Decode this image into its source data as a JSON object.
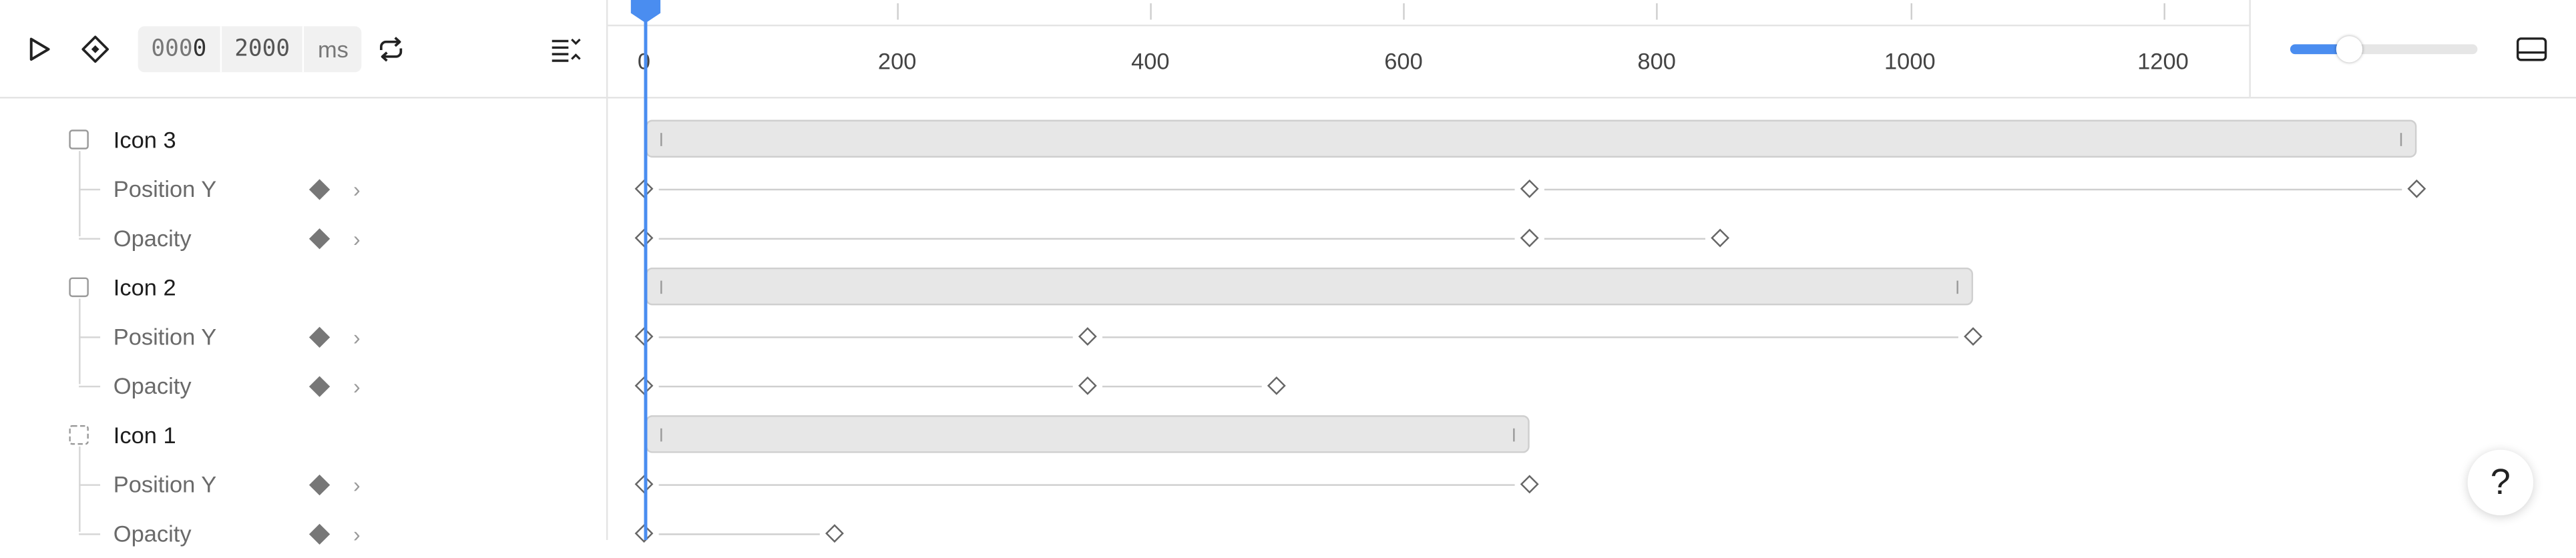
{
  "toolbar": {
    "current_time_prefix": "000",
    "current_time_last": "0",
    "duration": "2000",
    "unit": "ms"
  },
  "ruler": {
    "labels": [
      "0",
      "200",
      "400",
      "600",
      "800",
      "1000",
      "1200"
    ]
  },
  "layers": [
    {
      "name": "Icon 3",
      "props": [
        {
          "name": "Position Y"
        },
        {
          "name": "Opacity"
        }
      ]
    },
    {
      "name": "Icon 2",
      "props": [
        {
          "name": "Position Y"
        },
        {
          "name": "Opacity"
        }
      ]
    },
    {
      "name": "Icon 1",
      "props": [
        {
          "name": "Position Y"
        },
        {
          "name": "Opacity"
        }
      ]
    }
  ],
  "timeline": {
    "duration_ms": 2000,
    "playhead_ms": 0,
    "zoom_level": 0.3,
    "tracks": [
      {
        "bar_end_ms": 1400,
        "posY_keys_ms": [
          0,
          700,
          1400
        ],
        "opacity_keys_ms": [
          0,
          700,
          850
        ]
      },
      {
        "bar_end_ms": 1050,
        "posY_keys_ms": [
          0,
          350,
          1050
        ],
        "opacity_keys_ms": [
          0,
          350,
          500
        ]
      },
      {
        "bar_end_ms": 700,
        "posY_keys_ms": [
          0,
          700
        ],
        "opacity_keys_ms": [
          0,
          150
        ]
      }
    ]
  },
  "help": {
    "label": "?"
  },
  "colors": {
    "accent": "#4a8df0",
    "bar": "#e7e7e7",
    "border": "#e4e4e4"
  }
}
